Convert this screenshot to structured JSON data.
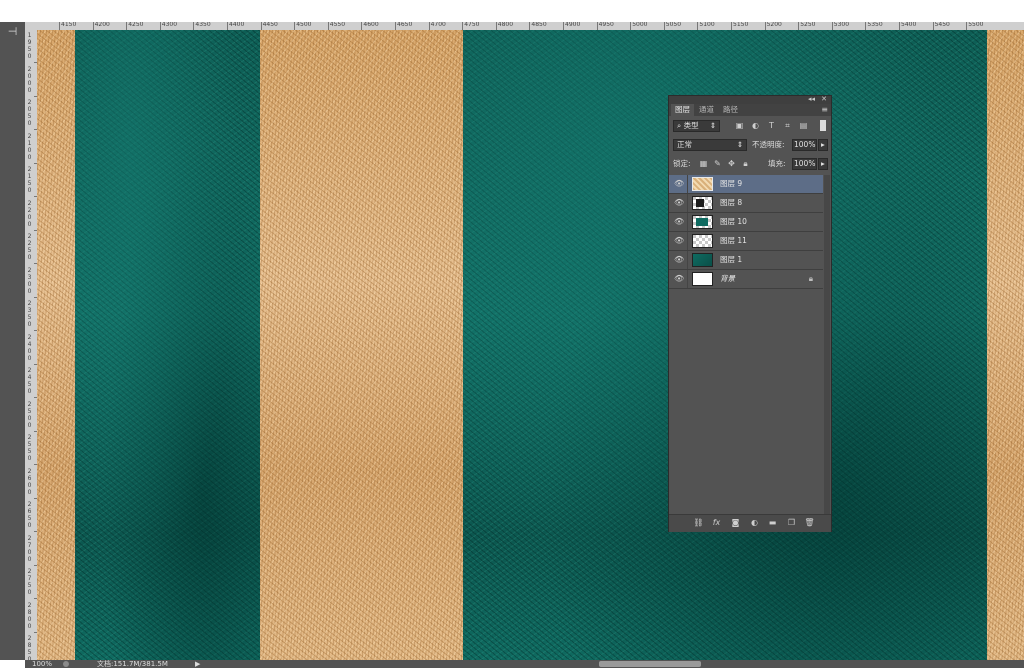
{
  "ruler": {
    "h_labels": [
      "4150",
      "4200",
      "4250",
      "4300",
      "4350",
      "4400",
      "4450",
      "4500",
      "4550",
      "4600",
      "4650",
      "4700",
      "4750",
      "4800",
      "4850",
      "4900",
      "4950",
      "5000",
      "5050",
      "5100",
      "5150",
      "5200",
      "5250",
      "5300",
      "5350",
      "5400",
      "5450",
      "5500"
    ],
    "v_labels": [
      "1950",
      "2000",
      "2050",
      "2100",
      "2150",
      "2200",
      "2250",
      "2300",
      "2350",
      "2400",
      "2450",
      "2500",
      "2550",
      "2600",
      "2650",
      "2700",
      "2750",
      "2800",
      "2850"
    ]
  },
  "status": {
    "zoom": "100%",
    "doc": "文档:151.7M/381.5M"
  },
  "colors": {
    "ui_dark": "#535353",
    "selection": "#5d6d87",
    "gold": "#e0b480",
    "teal": "#0f675d"
  },
  "panel": {
    "tabs": [
      "图层",
      "通道",
      "路径"
    ],
    "active_tab": 0,
    "filter_kind": "类型",
    "blend_mode": "正常",
    "opacity_label": "不透明度:",
    "opacity_value": "100%",
    "lock_label": "锁定:",
    "fill_label": "填充:",
    "fill_value": "100%",
    "layers": [
      {
        "name": "图层 9",
        "selected": true,
        "thumb": "gold"
      },
      {
        "name": "图层 8",
        "selected": false,
        "thumb": "transparent-dark"
      },
      {
        "name": "图层 10",
        "selected": false,
        "thumb": "transparent-teal"
      },
      {
        "name": "图层 11",
        "selected": false,
        "thumb": "transparent"
      },
      {
        "name": "图层 1",
        "selected": false,
        "thumb": "teal"
      },
      {
        "name": "背景",
        "selected": false,
        "thumb": "white",
        "locked": true
      }
    ],
    "footer_icons": [
      "link-icon",
      "fx-icon",
      "mask-icon",
      "adjustment-icon",
      "folder-icon",
      "new-layer-icon",
      "trash-icon"
    ]
  }
}
